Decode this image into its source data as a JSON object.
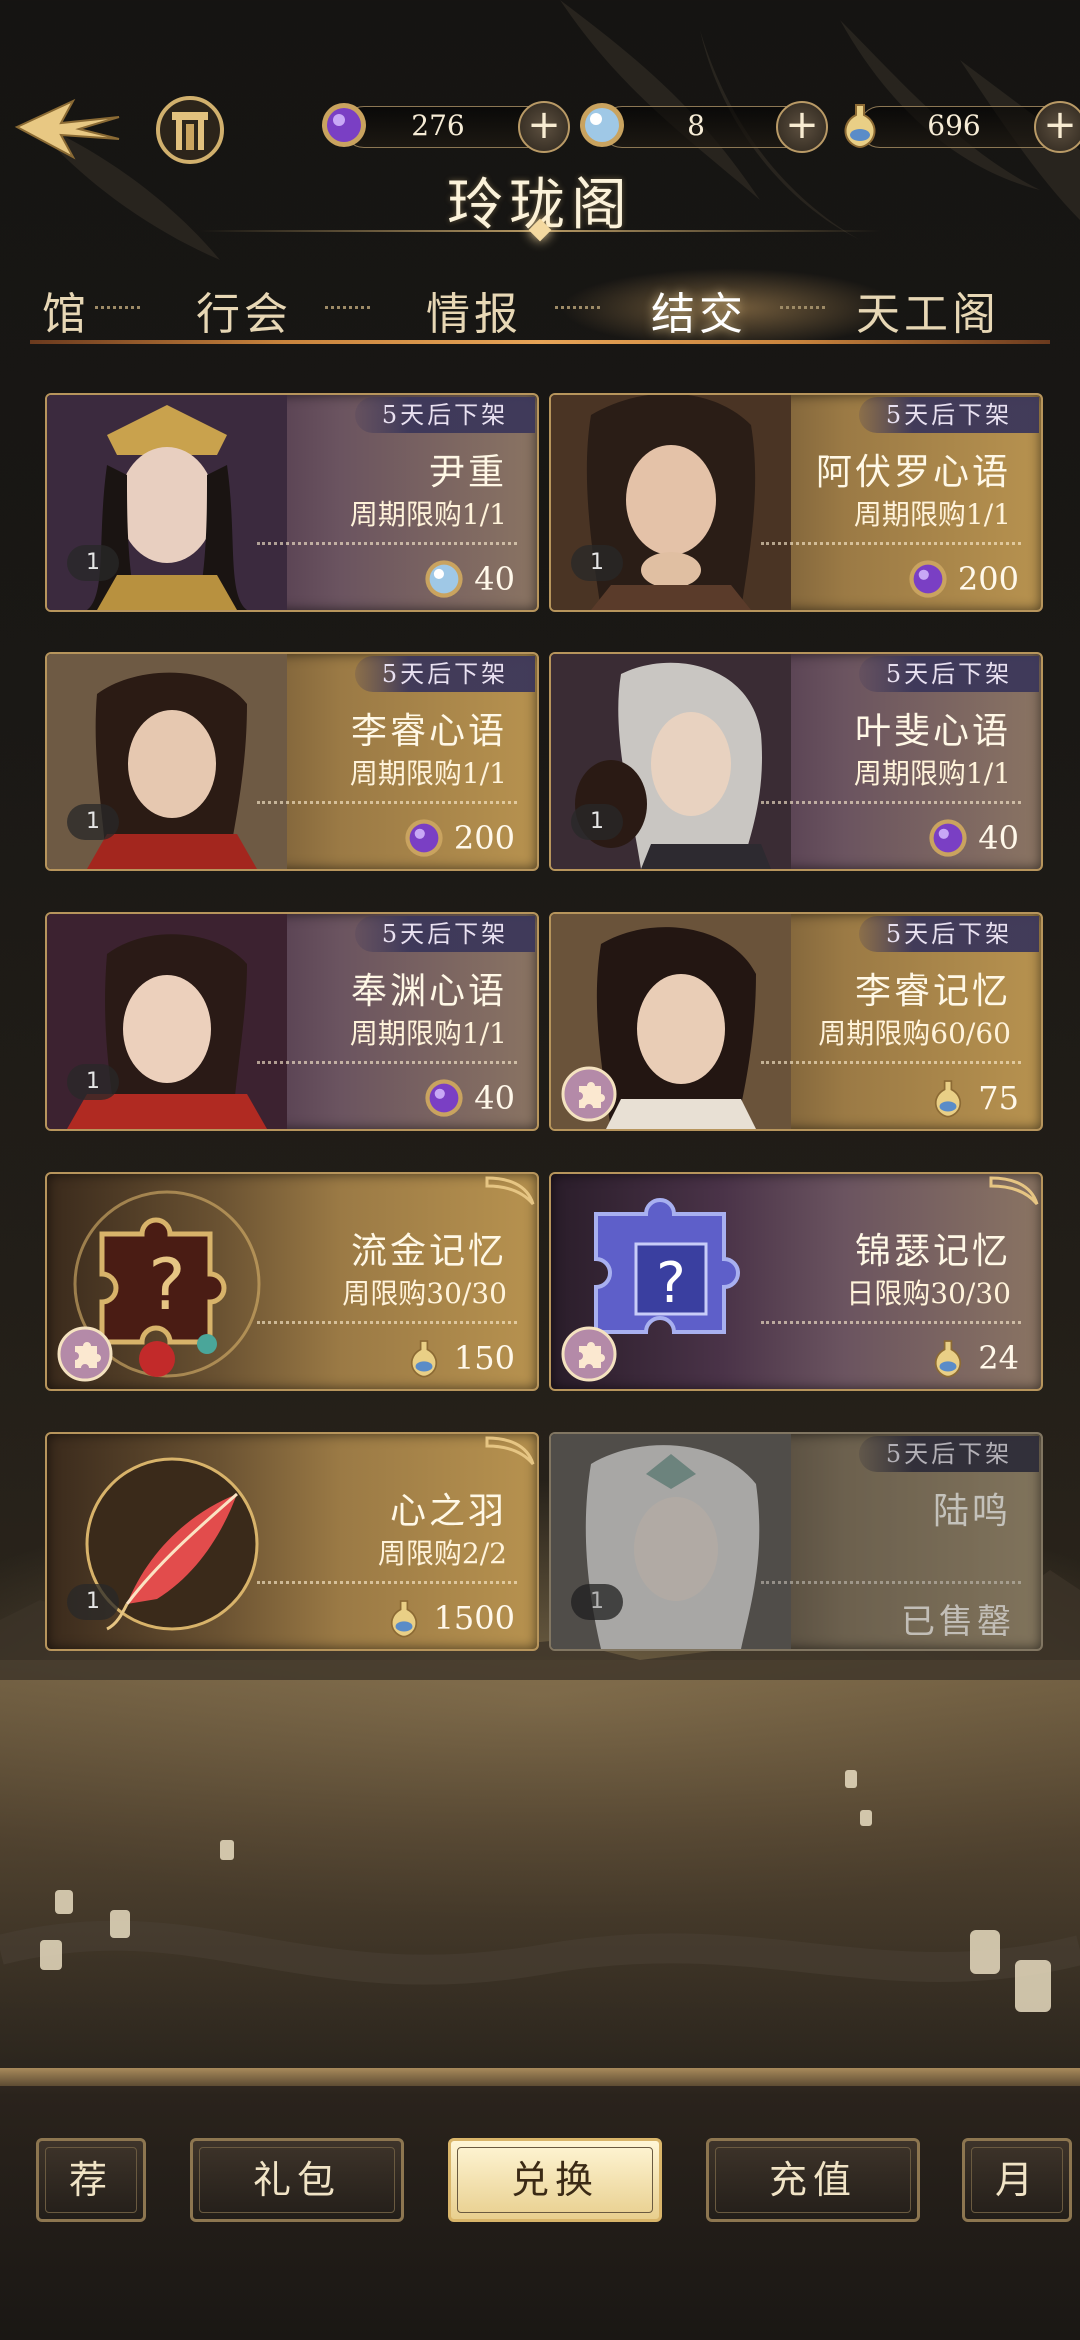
{
  "header": {
    "title": "玲珑阁",
    "currencies": [
      {
        "icon": "purple-orb-icon",
        "value": "276"
      },
      {
        "icon": "blue-crystal-icon",
        "value": "8"
      },
      {
        "icon": "gold-bottle-icon",
        "value": "696"
      }
    ]
  },
  "tabs": [
    {
      "label": "馆"
    },
    {
      "label": "行会"
    },
    {
      "label": "情报"
    },
    {
      "label": "结交",
      "active": true
    },
    {
      "label": "天工阁"
    }
  ],
  "cards": [
    {
      "tag": "5天后下架",
      "name": "尹重",
      "limit": "周期限购1/1",
      "count": "1",
      "price": "40",
      "currency_icon": "blue-crystal-icon"
    },
    {
      "tag": "5天后下架",
      "name": "阿伏罗心语",
      "limit": "周期限购1/1",
      "count": "1",
      "price": "200",
      "currency_icon": "purple-orb-icon"
    },
    {
      "tag": "5天后下架",
      "name": "李睿心语",
      "limit": "周期限购1/1",
      "count": "1",
      "price": "200",
      "currency_icon": "purple-orb-icon"
    },
    {
      "tag": "5天后下架",
      "name": "叶斐心语",
      "limit": "周期限购1/1",
      "count": "1",
      "price": "40",
      "currency_icon": "purple-orb-icon"
    },
    {
      "tag": "5天后下架",
      "name": "奉渊心语",
      "limit": "周期限购1/1",
      "count": "1",
      "price": "40",
      "currency_icon": "purple-orb-icon"
    },
    {
      "tag": "5天后下架",
      "name": "李睿记忆",
      "limit": "周期限购60/60",
      "price": "75",
      "currency_icon": "gold-bottle-icon"
    },
    {
      "name": "流金记忆",
      "limit": "周限购30/30",
      "price": "150",
      "currency_icon": "gold-bottle-icon"
    },
    {
      "name": "锦瑟记忆",
      "limit": "日限购30/30",
      "price": "24",
      "currency_icon": "gold-bottle-icon"
    },
    {
      "name": "心之羽",
      "limit": "周限购2/2",
      "count": "1",
      "price": "1500",
      "currency_icon": "gold-bottle-icon"
    },
    {
      "tag": "5天后下架",
      "name": "陆鸣",
      "count": "1",
      "status": "已售罄"
    }
  ],
  "bottom_nav": [
    {
      "label": "荐"
    },
    {
      "label": "礼包"
    },
    {
      "label": "兑换",
      "active": true
    },
    {
      "label": "充值"
    },
    {
      "label": "月"
    }
  ]
}
